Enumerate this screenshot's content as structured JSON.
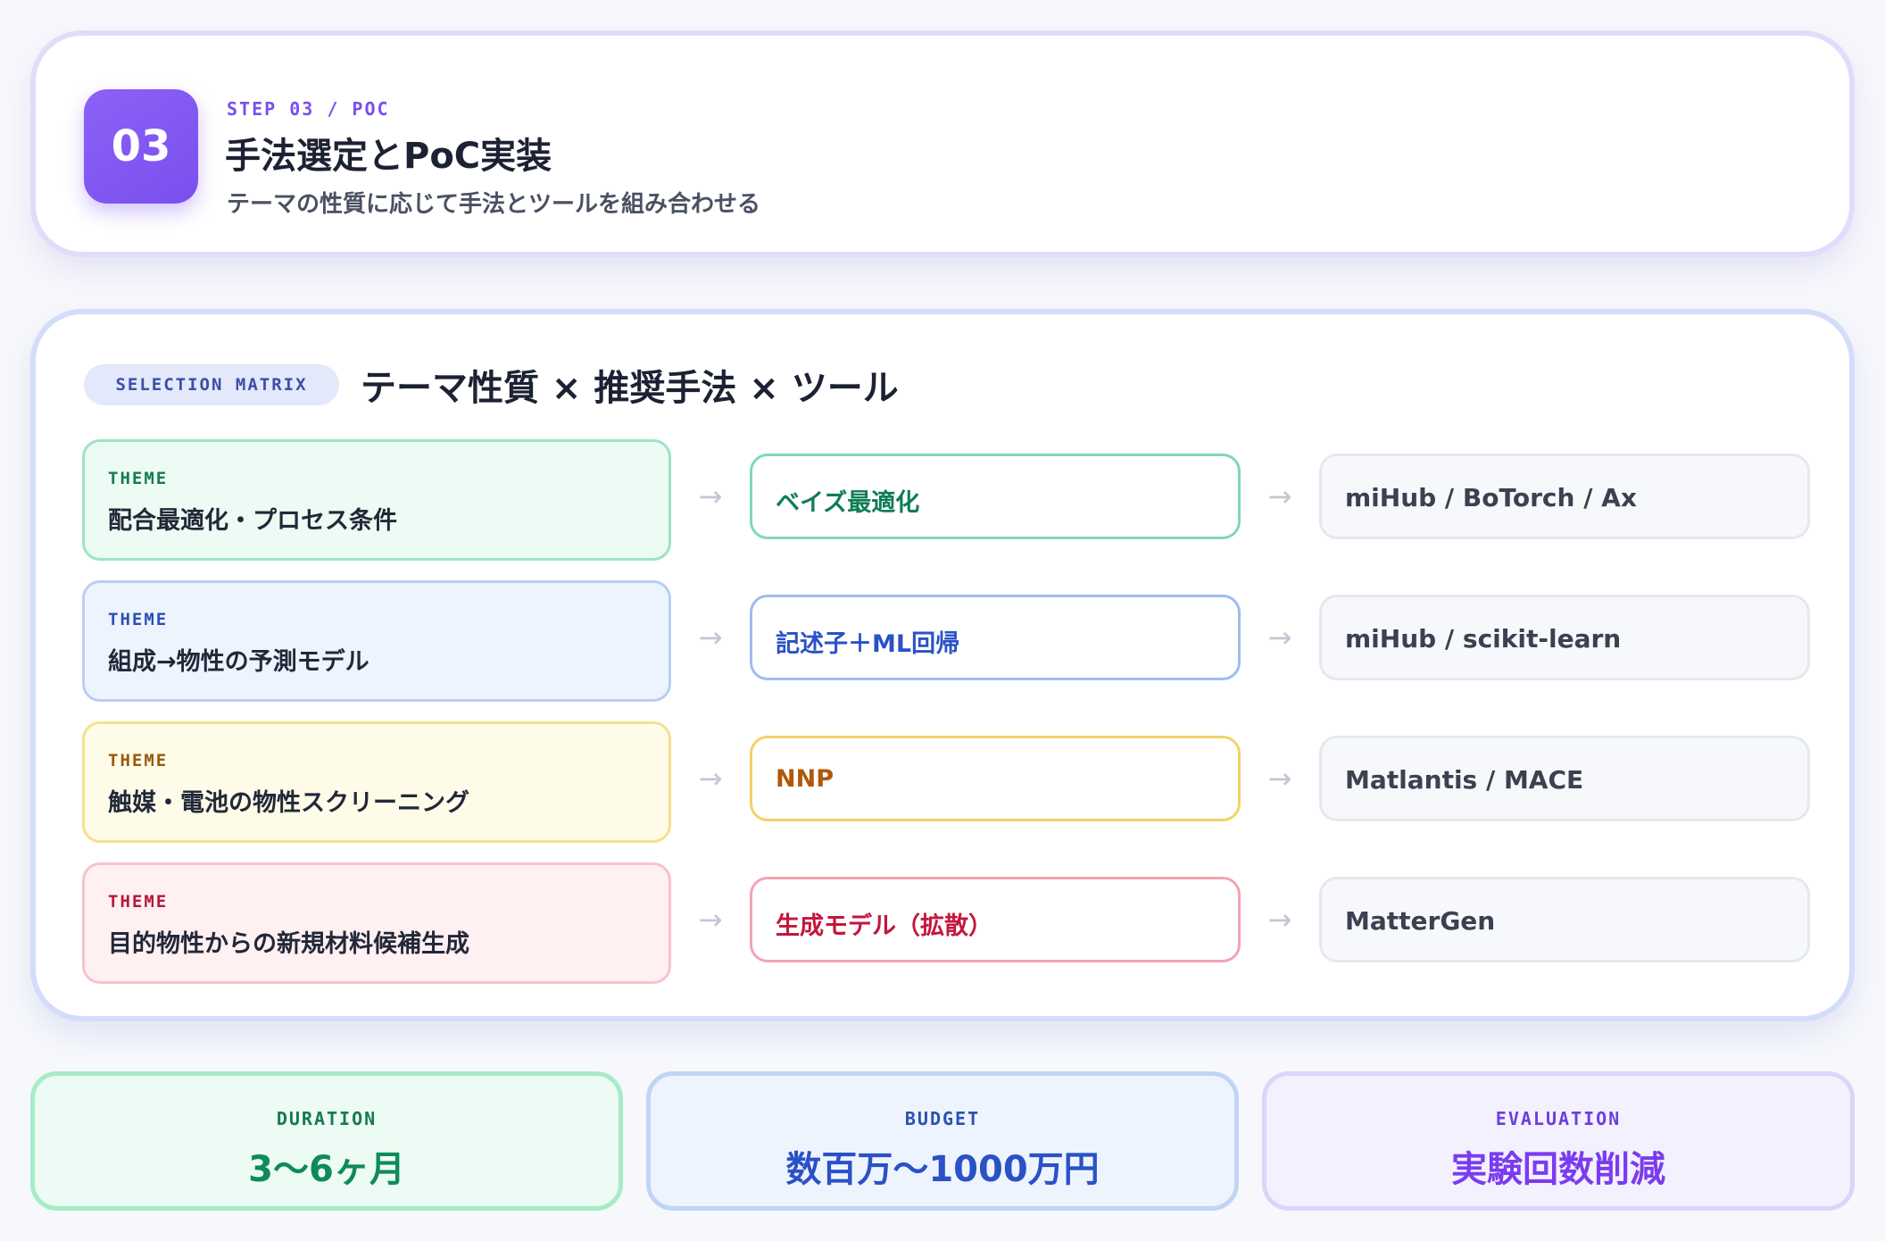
{
  "header": {
    "step_number": "03",
    "kicker": "STEP 03 / POC",
    "title": "手法選定とPoC実装",
    "subtitle": "テーマの性質に応じて手法とツールを組み合わせる"
  },
  "matrix": {
    "pill_label": "SELECTION MATRIX",
    "title": "テーマ性質 × 推奨手法 × ツール",
    "rows": [
      {
        "theme_label": "THEME",
        "theme": "配合最適化・プロセス条件",
        "method": "ベイズ最適化",
        "tool": "miHub / BoTorch / Ax",
        "color": "#0f7d55"
      },
      {
        "theme_label": "THEME",
        "theme": "組成→物性の予測モデル",
        "method": "記述子＋ML回帰",
        "tool": "miHub / scikit-learn",
        "color": "#2a51c7"
      },
      {
        "theme_label": "THEME",
        "theme": "触媒・電池の物性スクリーニング",
        "method": "NNP",
        "tool": "Matlantis / MACE",
        "color": "#b0580a"
      },
      {
        "theme_label": "THEME",
        "theme": "目的物性からの新規材料候補生成",
        "method": "生成モデル（拡散）",
        "tool": "MatterGen",
        "color": "#c4163d"
      }
    ],
    "arrow_icon": "arrow-right-icon"
  },
  "stats": {
    "duration": {
      "label": "DURATION",
      "value": "3〜6ヶ月"
    },
    "budget": {
      "label": "BUDGET",
      "value": "数百万〜1000万円"
    },
    "evaluation": {
      "label": "EVALUATION",
      "value": "実験回数削減"
    }
  },
  "colors": {
    "accent_purple": "#7a4fee",
    "green": "#0f7d55",
    "blue": "#2a51c7",
    "yellow": "#b0580a",
    "red": "#c4163d"
  }
}
